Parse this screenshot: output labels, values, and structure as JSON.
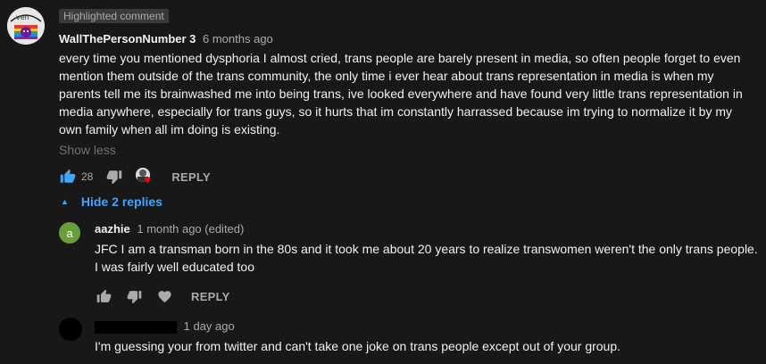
{
  "main_comment": {
    "badge": "Highlighted comment",
    "author": "WallThePersonNumber 3",
    "timestamp": "6 months ago",
    "avatar_icon": "rainbow-avatar-icon",
    "text_lines": [
      "every time you mentioned dysphoria I almost cried, trans people are barely present in media, so often people forget to even",
      "mention them outside of the trans community, the only time i ever hear about trans representation in media is when my",
      "parents tell me its brainwashed me into being trans, ive looked everywhere and have found very little trans representation in",
      "media anywhere, especially for trans guys, so it hurts that im constantly harrassed because im trying to normalize it by my",
      "own family when all im doing is existing."
    ],
    "show_less": "Show less",
    "like_count": "28",
    "reply_label": "REPLY"
  },
  "replies_toggle": {
    "label": "Hide 2 replies"
  },
  "replies": [
    {
      "avatar_letter": "a",
      "author": "aazhie",
      "meta": "1 month ago (edited)",
      "text_lines": [
        "JFC I am a transman born in the 80s and it took me about 20 years to realize transwomen weren't the only trans people.",
        "I was fairly well educated too"
      ],
      "reply_label": "REPLY"
    },
    {
      "meta": "1 day ago",
      "text_lines": [
        "I'm guessing your from twitter and can't take one joke on trans people except out of your group."
      ]
    }
  ],
  "colors": {
    "background": "#181818",
    "text": "#f1f1f1",
    "muted": "#aaaaaa",
    "link_blue": "#3ea6ff",
    "like_active": "#3ea6ff",
    "heart": "#ff0000",
    "reply_avatar": "#689f38"
  }
}
